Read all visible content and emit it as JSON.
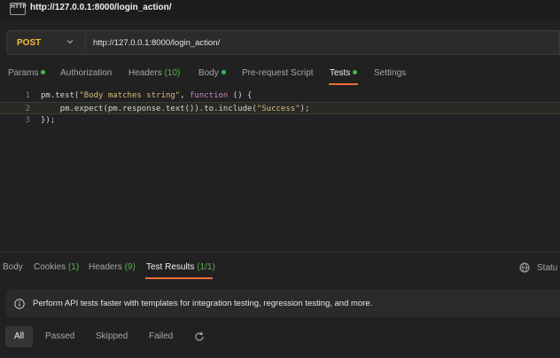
{
  "titlebar": {
    "badge": "HTTP",
    "title": "http://127.0.0.1:8000/login_action/"
  },
  "request": {
    "method": "POST",
    "url": "http://127.0.0.1:8000/login_action/"
  },
  "request_tabs": [
    {
      "label": "Params",
      "count": "",
      "dot": true
    },
    {
      "label": "Authorization",
      "count": "",
      "dot": false
    },
    {
      "label": "Headers",
      "count": "(10)",
      "dot": false
    },
    {
      "label": "Body",
      "count": "",
      "dot": true
    },
    {
      "label": "Pre-request Script",
      "count": "",
      "dot": false
    },
    {
      "label": "Tests",
      "count": "",
      "dot": true,
      "active": true
    },
    {
      "label": "Settings",
      "count": "",
      "dot": false
    }
  ],
  "editor": {
    "lines": [
      {
        "n": "1"
      },
      {
        "n": "2"
      },
      {
        "n": "3"
      }
    ],
    "code": {
      "l1_a": "pm.test(",
      "l1_str": "\"Body matches string\"",
      "l1_b": ", ",
      "l1_kw": "function",
      "l1_c": " () {",
      "l2_a": "    pm.expect(pm.response.text()).to.include(",
      "l2_str": "\"Success\"",
      "l2_b": ");",
      "l3": "});"
    }
  },
  "response_tabs": [
    {
      "label": "Body",
      "count": ""
    },
    {
      "label": "Cookies",
      "count": "(1)"
    },
    {
      "label": "Headers",
      "count": "(9)"
    },
    {
      "label": "Test Results",
      "count": "(1/1)",
      "active": true
    }
  ],
  "status": {
    "label": "Statu"
  },
  "banner": {
    "text": "Perform API tests faster with templates for integration testing, regression testing, and more."
  },
  "filters": [
    "All",
    "Passed",
    "Skipped",
    "Failed"
  ],
  "icons": {
    "method_caret": "chevron-down-icon",
    "status": "globe-icon",
    "banner": "info-icon",
    "refresh": "refresh-icon"
  },
  "colors": {
    "accent": "#f26b3a",
    "method": "#f5c13c",
    "success": "#3fb950"
  }
}
